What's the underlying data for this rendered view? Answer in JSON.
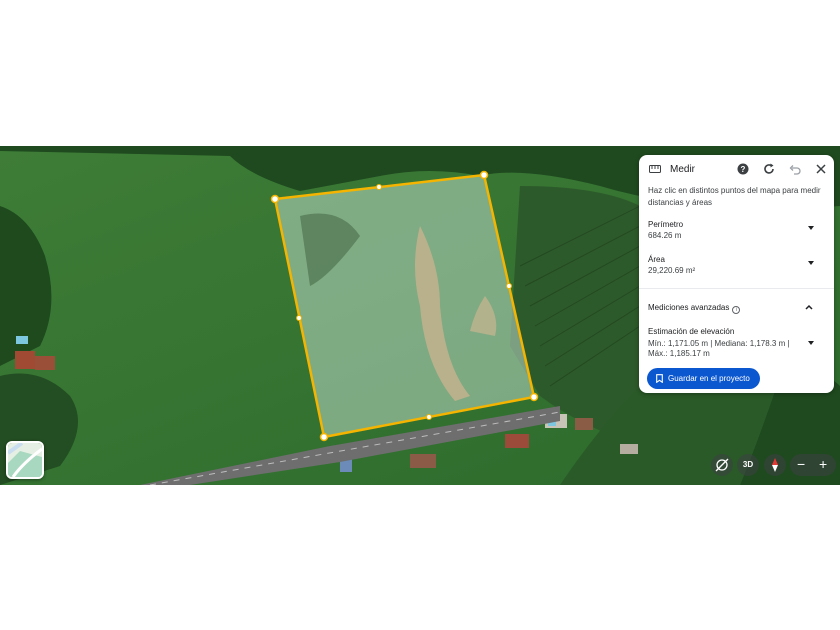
{
  "panel": {
    "title": "Medir",
    "description": "Haz clic en distintos puntos del mapa para medir distancias y áreas",
    "perimeter": {
      "label": "Perímetro",
      "value": "684.26 m"
    },
    "area": {
      "label": "Área",
      "value": "29,220.69 m²"
    },
    "advanced": {
      "label": "Mediciones avanzadas"
    },
    "elevation": {
      "label": "Estimación de elevación",
      "line1": "Mín.: 1,171.05 m | Mediana: 1,178.3 m |",
      "line2": "Máx.: 1,185.17 m"
    },
    "save_button": "Guardar en el proyecto",
    "icons": [
      "ruler-icon",
      "help-icon",
      "refresh-icon",
      "undo-icon",
      "close-icon"
    ]
  },
  "map_controls": {
    "three_d_label": "3D",
    "zoom_out_label": "−",
    "zoom_in_label": "+",
    "icons": [
      "hide-labels-icon",
      "compass-icon",
      "map-layers-thumbnail"
    ]
  },
  "colors": {
    "measure_line": "#f4b400",
    "accent": "#0b57d0"
  }
}
